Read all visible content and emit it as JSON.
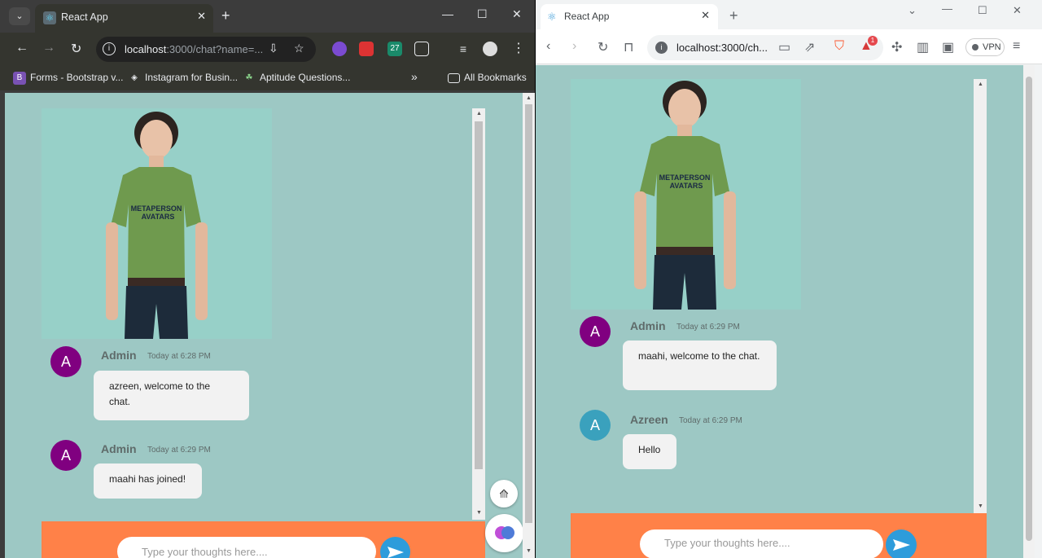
{
  "left_window": {
    "tab_title": "React App",
    "url_host": "localhost",
    "url_rest": ":3000/chat?name=...",
    "bookmarks": [
      {
        "label": "Forms - Bootstrap v...",
        "icon": "bootstrap-icon"
      },
      {
        "label": "Instagram for Busin...",
        "icon": "stack-icon"
      },
      {
        "label": "Aptitude Questions...",
        "icon": "brain-icon"
      }
    ],
    "bookmarks_more": "»",
    "all_bookmarks_label": "All Bookmarks",
    "chat": {
      "messages": [
        {
          "initial": "A",
          "user": "Admin",
          "time": "Today at 6:28 PM",
          "text": "azreen, welcome to the chat.",
          "color": "#800080"
        },
        {
          "initial": "A",
          "user": "Admin",
          "time": "Today at 6:29 PM",
          "text": "maahi has joined!",
          "color": "#800080"
        }
      ],
      "input_placeholder": "Type your thoughts here...."
    },
    "shirt_text": [
      "METAPERSON",
      "AVATARS"
    ]
  },
  "right_window": {
    "tab_title": "React App",
    "url": "localhost:3000/ch...",
    "vpn_label": "VPN",
    "brave_badge": "1",
    "chat": {
      "messages": [
        {
          "initial": "A",
          "user": "Admin",
          "time": "Today at 6:29 PM",
          "text": "maahi, welcome to the chat.",
          "color": "#800080"
        },
        {
          "initial": "A",
          "user": "Azreen",
          "time": "Today at 6:29 PM",
          "text": "Hello",
          "color": "#3aa1bd"
        }
      ],
      "input_placeholder": "Type your thoughts here...."
    },
    "shirt_text": [
      "METAPERSON",
      "AVATARS"
    ]
  },
  "colors": {
    "chat_bg": "#9dc8c4",
    "footer": "#ff8148",
    "send": "#2d9cdb",
    "admin": "#800080",
    "azreen": "#3aa1bd"
  }
}
